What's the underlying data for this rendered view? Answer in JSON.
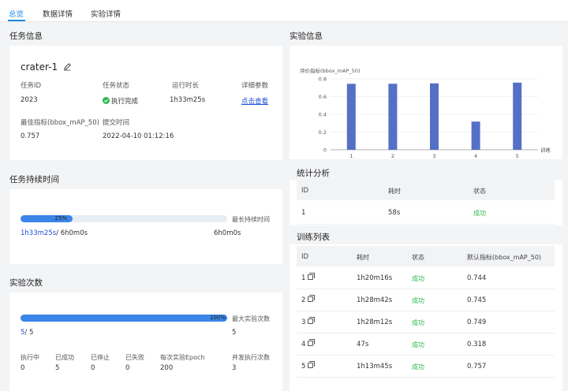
{
  "tabs": [
    {
      "label": "总览"
    },
    {
      "label": "数据详情"
    },
    {
      "label": "实验详情"
    }
  ],
  "task_info": {
    "section_title": "任务信息",
    "name": "crater-1",
    "fields": {
      "task_id_label": "任务ID",
      "task_id_value": "2023",
      "status_label": "任务状态",
      "status_value": "执行完成",
      "runtime_label": "运行时长",
      "runtime_value": "1h33m25s",
      "params_label": "详细参数",
      "params_link": "点击查看",
      "best_metric_label": "最佳指标(bbox_mAP_50)",
      "best_metric_value": "0.757",
      "submit_time_label": "提交时间",
      "submit_time_value": "2022-04-10 01:12:16"
    }
  },
  "duration": {
    "section_title": "任务持续时间",
    "progress": 25,
    "progress_text": "25%",
    "max_label": "最长持续时间",
    "used": "1h33m25s",
    "separator": "/ 6h0m0s",
    "max_value": "6h0m0s"
  },
  "runs": {
    "section_title": "实验次数",
    "progress": 100,
    "progress_text": "100%",
    "max_label": "最大实验次数",
    "max_value": "5",
    "count_done": "5",
    "count_sep": "/ 5",
    "stats": [
      {
        "label": "执行中",
        "value": "0"
      },
      {
        "label": "已成功",
        "value": "5"
      },
      {
        "label": "已停止",
        "value": "0"
      },
      {
        "label": "已失败",
        "value": "0"
      },
      {
        "label": "每次实验Epoch",
        "value": "200"
      },
      {
        "label": "并发执行次数",
        "value": "3"
      }
    ]
  },
  "experiment_info": {
    "section_title": "实验信息"
  },
  "chart_data": {
    "type": "bar",
    "ylabel": "评价指标(bbox_mAP_50)",
    "xlabel": "训练",
    "categories": [
      "1",
      "2",
      "3",
      "4",
      "5"
    ],
    "values": [
      0.744,
      0.745,
      0.749,
      0.318,
      0.757
    ],
    "ylim": [
      0,
      0.8
    ],
    "yticks": [
      "0",
      "0.2",
      "0.4",
      "0.6",
      "0.8"
    ],
    "grid": true,
    "bar_color": "#5470c6"
  },
  "stats_analysis": {
    "section_title": "统计分析",
    "headers": [
      "ID",
      "耗时",
      "状态"
    ],
    "rows": [
      {
        "id": "1",
        "time": "58s",
        "status": "成功"
      }
    ]
  },
  "training_list": {
    "section_title": "训练列表",
    "headers": [
      "ID",
      "耗时",
      "状态",
      "默认指标(bbox_mAP_50)"
    ],
    "rows": [
      {
        "id": "1",
        "time": "1h20m16s",
        "status": "成功",
        "metric": "0.744"
      },
      {
        "id": "2",
        "time": "1h28m42s",
        "status": "成功",
        "metric": "0.745"
      },
      {
        "id": "3",
        "time": "1h28m12s",
        "status": "成功",
        "metric": "0.749"
      },
      {
        "id": "4",
        "time": "47s",
        "status": "成功",
        "metric": "0.318"
      },
      {
        "id": "5",
        "time": "1h13m45s",
        "status": "成功",
        "metric": "0.757"
      }
    ]
  },
  "colors": {
    "accent": "#1e88e5",
    "success": "#2db84d",
    "progress": "#3a86e8",
    "link": "#1e4fd8"
  }
}
